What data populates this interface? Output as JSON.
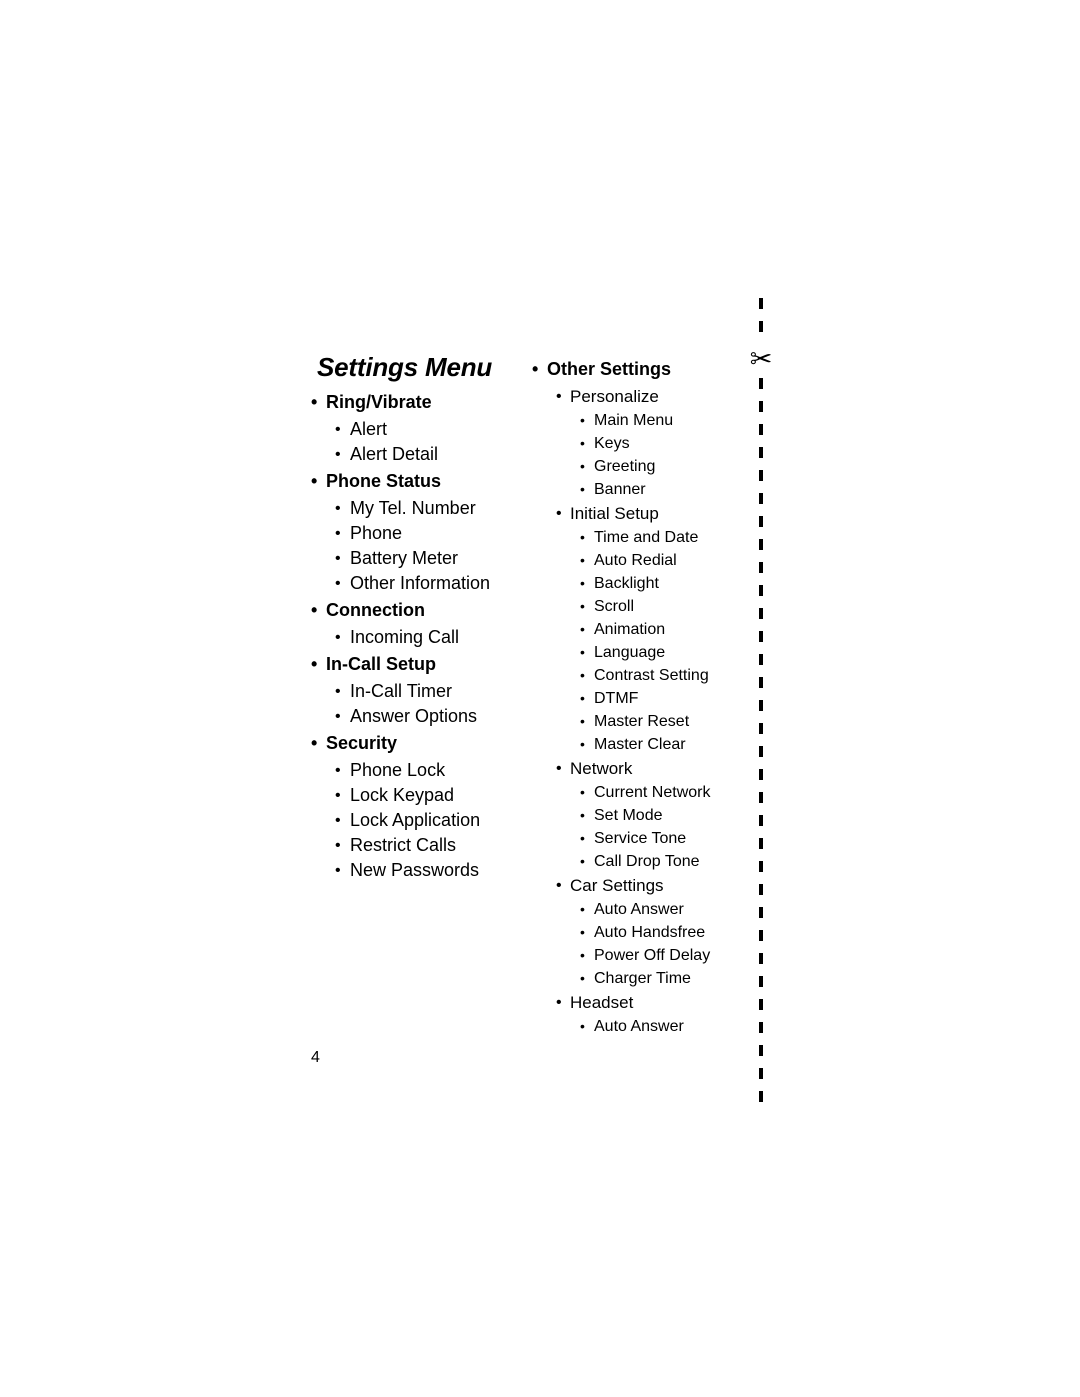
{
  "document": {
    "title": "Settings Menu",
    "page_number": "4"
  },
  "cut_line": {
    "scissors_icon": "scissors-icon",
    "glyph": "✂"
  },
  "left_column": {
    "groups": [
      {
        "heading": "Ring/Vibrate",
        "items": [
          "Alert",
          "Alert Detail"
        ]
      },
      {
        "heading": "Phone Status",
        "items": [
          "My Tel. Number",
          "Phone",
          "Battery Meter",
          "Other Information"
        ]
      },
      {
        "heading": "Connection",
        "items": [
          "Incoming Call"
        ]
      },
      {
        "heading": "In-Call Setup",
        "items": [
          "In-Call Timer",
          "Answer Options"
        ]
      },
      {
        "heading": "Security",
        "items": [
          "Phone Lock",
          "Lock Keypad",
          "Lock Application",
          "Restrict Calls",
          "New Passwords"
        ]
      }
    ]
  },
  "right_column": {
    "heading": "Other Settings",
    "groups": [
      {
        "label": "Personalize",
        "items": [
          "Main Menu",
          "Keys",
          "Greeting",
          "Banner"
        ]
      },
      {
        "label": "Initial Setup",
        "items": [
          "Time and Date",
          "Auto Redial",
          "Backlight",
          "Scroll",
          "Animation",
          "Language",
          "Contrast Setting",
          "DTMF",
          "Master Reset",
          "Master Clear"
        ]
      },
      {
        "label": "Network",
        "items": [
          "Current Network",
          "Set Mode",
          "Service Tone",
          "Call Drop Tone"
        ]
      },
      {
        "label": "Car Settings",
        "items": [
          "Auto Answer",
          "Auto Handsfree",
          "Power Off Delay",
          "Charger Time"
        ]
      },
      {
        "label": "Headset",
        "items": [
          "Auto Answer"
        ]
      }
    ]
  },
  "bullet": {
    "glyph": "•"
  }
}
